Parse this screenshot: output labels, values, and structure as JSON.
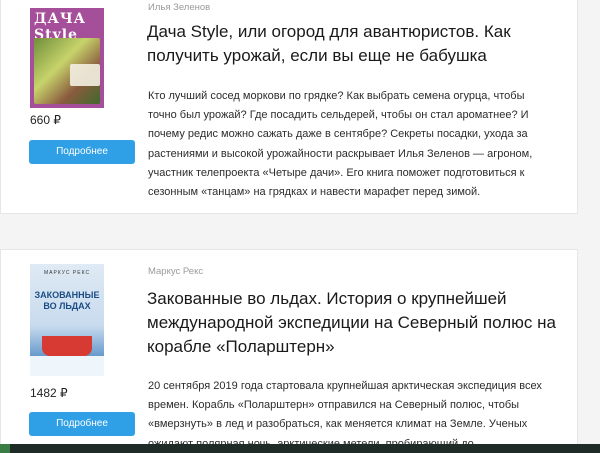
{
  "books": [
    {
      "author": "Илья Зеленов",
      "title": "Дача Style, или огород для авантюристов. Как получить урожай, если вы еще не бабушка",
      "price": "660 ₽",
      "button_label": "Подробнее",
      "cover": {
        "title": "ДАЧА Style",
        "colors": {
          "background": "#a54f9a"
        }
      },
      "description": "Кто лучший сосед моркови по грядке? Как выбрать семена огурца, чтобы точно был урожай? Где посадить сельдерей, чтобы он стал ароматнее? И почему редис можно сажать даже в сентябре? Секреты посадки, ухода за растениями и высокой урожайности раскрывает Илья Зеленов — агроном, участник телепроекта «Четыре дачи». Его книга поможет подготовиться к сезонным «танцам» на грядках и навести марафет перед зимой."
    },
    {
      "author": "Маркус Рекс",
      "title": "Закованные во льдах. История о крупнейшей международной экспедиции на Северный полюс на корабле «Поларштерн»",
      "price": "1482 ₽",
      "button_label": "Подробнее",
      "cover": {
        "author": "МАРКУС РЕКС",
        "title": "ЗАКОВАННЫЕ ВО ЛЬДАХ",
        "colors": {
          "background": "#c8dbee"
        }
      },
      "description": "20 сентября 2019 года стартовала крупнейшая арктическая экспедиция всех времен. Корабль «Поларштерн» отправился на Северный полюс, чтобы «вмерзнуть» в лед и разобраться, как меняется климат на Земле. Ученых ожидают полярная ночь, арктические метели, пробирающий до"
    }
  ],
  "colors": {
    "accent": "#2f9fe6",
    "author_text": "#9a9a9a",
    "page_background": "#f4f4f4"
  }
}
